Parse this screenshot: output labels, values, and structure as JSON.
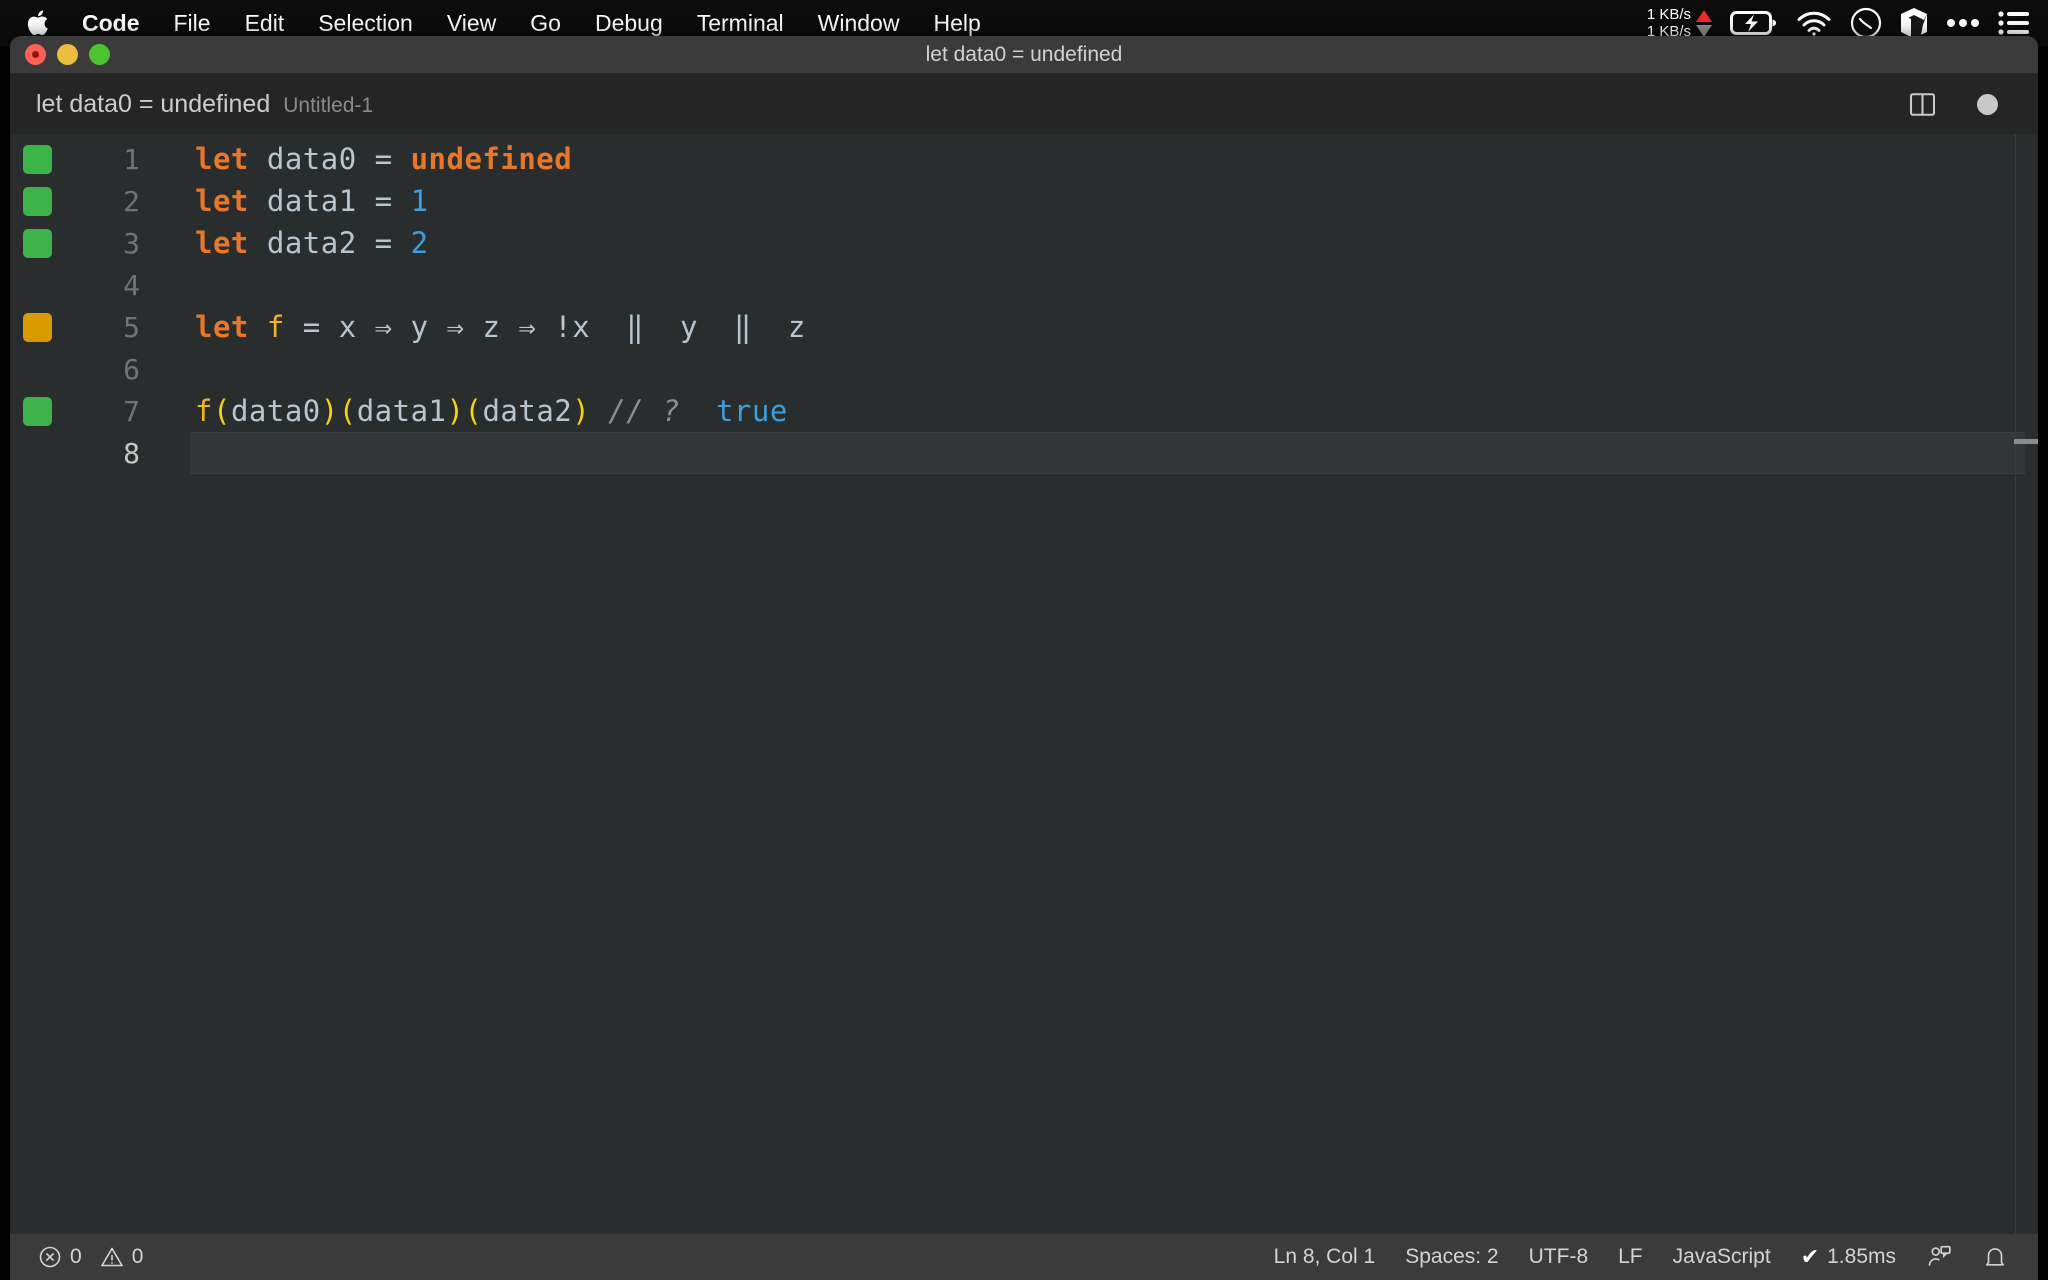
{
  "menubar": {
    "apple_icon": "apple-logo-icon",
    "items": [
      {
        "label": "Code",
        "bold": true
      },
      {
        "label": "File",
        "bold": false
      },
      {
        "label": "Edit",
        "bold": false
      },
      {
        "label": "Selection",
        "bold": false
      },
      {
        "label": "View",
        "bold": false
      },
      {
        "label": "Go",
        "bold": false
      },
      {
        "label": "Debug",
        "bold": false
      },
      {
        "label": "Terminal",
        "bold": false
      },
      {
        "label": "Window",
        "bold": false
      },
      {
        "label": "Help",
        "bold": false
      }
    ],
    "network": {
      "upload": "1 KB/s",
      "download": "1 KB/s",
      "upload_arrow_color": "#ee2b2b",
      "download_arrow_color": "#8d8d8d"
    },
    "status_icons": [
      "battery-charging-icon",
      "wifi-icon",
      "siri-icon",
      "cube-icon",
      "ellipsis-icon",
      "control-center-icon"
    ]
  },
  "window": {
    "title": "let data0 = undefined",
    "traffic_lights": [
      "close",
      "minimize",
      "zoom"
    ]
  },
  "editor_header": {
    "breadcrumb_main": "let data0 = undefined",
    "breadcrumb_file": "Untitled-1",
    "split_editor_icon": "split-editor-icon",
    "unsaved_indicator": "dirty-dot-icon"
  },
  "editor": {
    "language": "JavaScript",
    "active_line": 8,
    "colors": {
      "background": "#2a2d2e",
      "keyword": "#e8772a",
      "identifier": "#b8c6d0",
      "number": "#3d9ddd",
      "function": "#f3c154",
      "bracket": "#f5d312",
      "comment": "#8a8f92",
      "inline_value": "#3d9ddd",
      "coverage_green": "#3cb44a",
      "coverage_amber": "#d99a00"
    },
    "lines": [
      {
        "number": "1",
        "coverage": "green",
        "tokens": [
          {
            "text": "let",
            "type": "kw"
          },
          {
            "text": " ",
            "type": "op"
          },
          {
            "text": "data0",
            "type": "var"
          },
          {
            "text": " ",
            "type": "op"
          },
          {
            "text": "=",
            "type": "op"
          },
          {
            "text": " ",
            "type": "op"
          },
          {
            "text": "undefined",
            "type": "const"
          }
        ]
      },
      {
        "number": "2",
        "coverage": "green",
        "tokens": [
          {
            "text": "let",
            "type": "kw"
          },
          {
            "text": " ",
            "type": "op"
          },
          {
            "text": "data1",
            "type": "var"
          },
          {
            "text": " ",
            "type": "op"
          },
          {
            "text": "=",
            "type": "op"
          },
          {
            "text": " ",
            "type": "op"
          },
          {
            "text": "1",
            "type": "num"
          }
        ]
      },
      {
        "number": "3",
        "coverage": "green",
        "tokens": [
          {
            "text": "let",
            "type": "kw"
          },
          {
            "text": " ",
            "type": "op"
          },
          {
            "text": "data2",
            "type": "var"
          },
          {
            "text": " ",
            "type": "op"
          },
          {
            "text": "=",
            "type": "op"
          },
          {
            "text": " ",
            "type": "op"
          },
          {
            "text": "2",
            "type": "num"
          }
        ]
      },
      {
        "number": "4",
        "coverage": "none",
        "tokens": []
      },
      {
        "number": "5",
        "coverage": "amber",
        "tokens": [
          {
            "text": "let",
            "type": "kw"
          },
          {
            "text": " ",
            "type": "op"
          },
          {
            "text": "f",
            "type": "fname"
          },
          {
            "text": " = ",
            "type": "op"
          },
          {
            "text": "x",
            "type": "var"
          },
          {
            "text": " ⇒ ",
            "type": "op"
          },
          {
            "text": "y",
            "type": "var"
          },
          {
            "text": " ⇒ ",
            "type": "op"
          },
          {
            "text": "z",
            "type": "var"
          },
          {
            "text": " ⇒ ",
            "type": "op"
          },
          {
            "text": "!x",
            "type": "var"
          },
          {
            "text": "  ‖  ",
            "type": "op"
          },
          {
            "text": "y",
            "type": "var"
          },
          {
            "text": "  ‖  ",
            "type": "op"
          },
          {
            "text": "z",
            "type": "var"
          }
        ]
      },
      {
        "number": "6",
        "coverage": "none",
        "tokens": []
      },
      {
        "number": "7",
        "coverage": "green",
        "tokens": [
          {
            "text": "f",
            "type": "fname"
          },
          {
            "text": "(",
            "type": "paren"
          },
          {
            "text": "data0",
            "type": "var"
          },
          {
            "text": ")",
            "type": "paren"
          },
          {
            "text": "(",
            "type": "paren"
          },
          {
            "text": "data1",
            "type": "var"
          },
          {
            "text": ")",
            "type": "paren"
          },
          {
            "text": "(",
            "type": "paren"
          },
          {
            "text": "data2",
            "type": "var"
          },
          {
            "text": ")",
            "type": "paren"
          },
          {
            "text": " ",
            "type": "op"
          },
          {
            "text": "// ?",
            "type": "comment"
          },
          {
            "text": "  ",
            "type": "op"
          },
          {
            "text": "true",
            "type": "val"
          }
        ]
      },
      {
        "number": "8",
        "coverage": "none",
        "tokens": [],
        "active": true
      }
    ]
  },
  "statusbar": {
    "errors_icon": "error-circle-icon",
    "errors_count": "0",
    "warnings_icon": "warning-triangle-icon",
    "warnings_count": "0",
    "cursor_position": "Ln 8, Col 1",
    "indentation": "Spaces: 2",
    "encoding": "UTF-8",
    "eol": "LF",
    "language_mode": "JavaScript",
    "quokka_check": "✔",
    "quokka_time": "1.85ms",
    "feedback_icon": "feedback-person-icon",
    "bell_icon": "bell-icon"
  }
}
